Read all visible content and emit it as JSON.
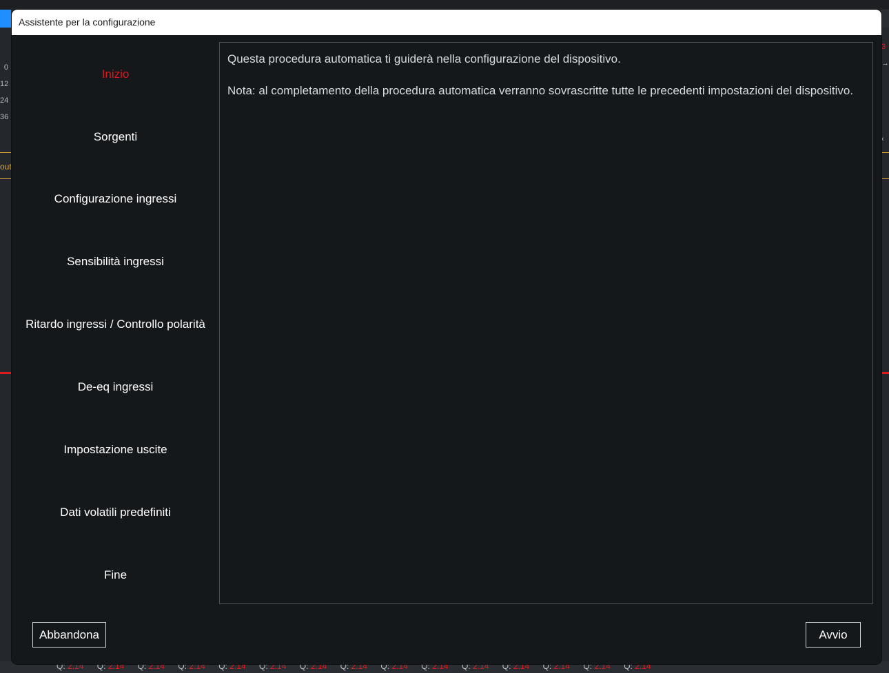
{
  "background": {
    "scale_labels": [
      "0",
      "12",
      "24",
      "36"
    ],
    "out_label": "out",
    "q_letter": "Q:",
    "q_value": "2.14",
    "q_count": 15
  },
  "dialog": {
    "title": "Assistente per la configurazione",
    "steps": [
      {
        "label": "Inizio",
        "active": true
      },
      {
        "label": "Sorgenti",
        "active": false
      },
      {
        "label": "Configurazione ingressi",
        "active": false
      },
      {
        "label": "Sensibilità ingressi",
        "active": false
      },
      {
        "label": "Ritardo ingressi / Controllo polarità",
        "active": false
      },
      {
        "label": "De-eq ingressi",
        "active": false
      },
      {
        "label": "Impostazione uscite",
        "active": false
      },
      {
        "label": "Dati volatili predefiniti",
        "active": false
      },
      {
        "label": "Fine",
        "active": false
      }
    ],
    "content": {
      "intro": "Questa procedura automatica ti guiderà nella configurazione del dispositivo.",
      "note": "Nota: al completamento della procedura automatica verranno sovrascritte tutte le precedenti impostazioni del dispositivo."
    },
    "buttons": {
      "abort": "Abbandona",
      "start": "Avvio"
    }
  },
  "colors": {
    "active_step": "#e5141c",
    "dialog_bg": "#15181b",
    "accent_blue": "#1f8fff"
  }
}
